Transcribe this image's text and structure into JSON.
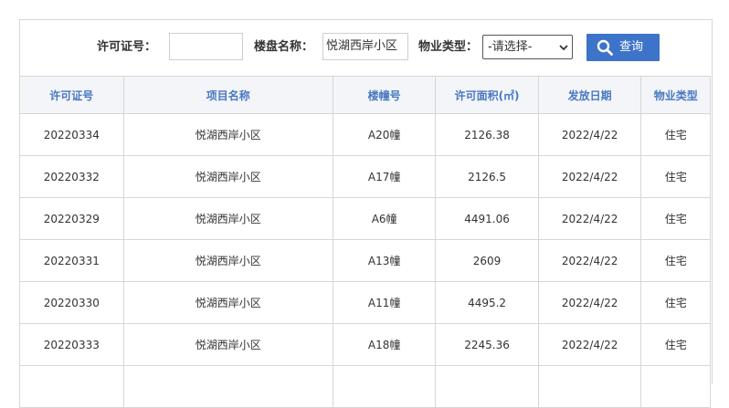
{
  "search": {
    "permit_label": "许可证号：",
    "permit_value": "",
    "project_label": "楼盘名称：",
    "project_value": "悦湖西岸小区",
    "type_label": "物业类型：",
    "type_selected": "-请选择-",
    "query_label": "查询"
  },
  "table": {
    "headers": [
      "许可证号",
      "项目名称",
      "楼幢号",
      "许可面积(㎡)",
      "发放日期",
      "物业类型"
    ],
    "rows": [
      [
        "20220334",
        "悦湖西岸小区",
        "A20幢",
        "2126.38",
        "2022/4/22",
        "住宅"
      ],
      [
        "20220332",
        "悦湖西岸小区",
        "A17幢",
        "2126.5",
        "2022/4/22",
        "住宅"
      ],
      [
        "20220329",
        "悦湖西岸小区",
        "A6幢",
        "4491.06",
        "2022/4/22",
        "住宅"
      ],
      [
        "20220331",
        "悦湖西岸小区",
        "A13幢",
        "2609",
        "2022/4/22",
        "住宅"
      ],
      [
        "20220330",
        "悦湖西岸小区",
        "A11幢",
        "4495.2",
        "2022/4/22",
        "住宅"
      ],
      [
        "20220333",
        "悦湖西岸小区",
        "A18幢",
        "2245.36",
        "2022/4/22",
        "住宅"
      ],
      [
        "",
        "",
        "",
        "",
        "",
        ""
      ]
    ]
  },
  "colors": {
    "accent": "#3d73c9",
    "header_text": "#4a78c2",
    "header_bg": "#f3f5f9",
    "border": "#d6d6d6"
  }
}
